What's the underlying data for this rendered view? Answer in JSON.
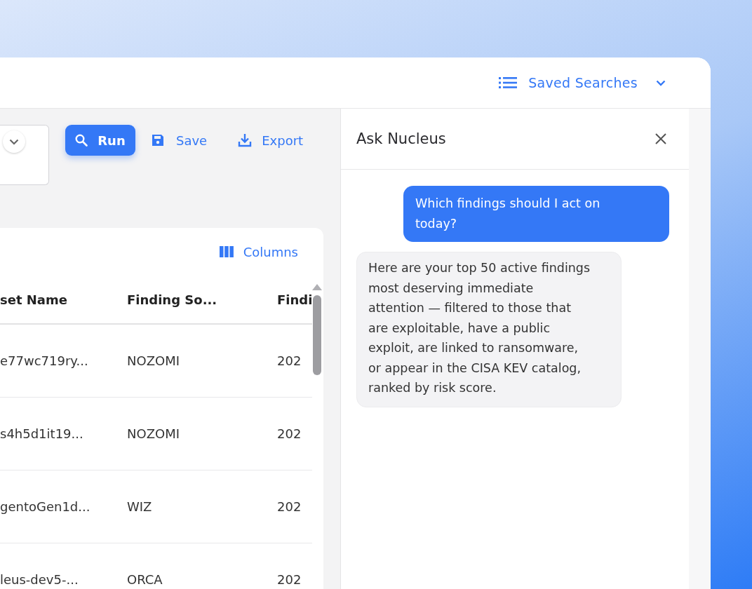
{
  "header": {
    "saved_searches": "Saved Searches"
  },
  "toolbar": {
    "buttons": [
      {
        "kind": "run",
        "label": "Run"
      },
      {
        "kind": "save",
        "label": "Save"
      },
      {
        "kind": "export",
        "label": "Export"
      }
    ]
  },
  "table": {
    "columns_button": "Columns",
    "columns": [
      "set Name",
      "Finding So...",
      "Findi"
    ],
    "rows": [
      [
        "e77wc719ry...",
        "NOZOMI",
        "202"
      ],
      [
        "s4h5d1it19...",
        "NOZOMI",
        "202"
      ],
      [
        "gentoGen1d...",
        "WIZ",
        "202"
      ],
      [
        "leus-dev5-...",
        "ORCA",
        "202"
      ]
    ]
  },
  "chat": {
    "title": "Ask Nucleus",
    "messages": [
      {
        "kind": "user",
        "text": "Which findings should I act on today?"
      },
      {
        "kind": "assistant",
        "text": "Here are your top 50 active findings most deserving immediate attention — filtered to those that are exploitable, have a public exploit, are linked to ransomware, or appear in the CISA KEV catalog, ranked by risk score."
      }
    ]
  }
}
